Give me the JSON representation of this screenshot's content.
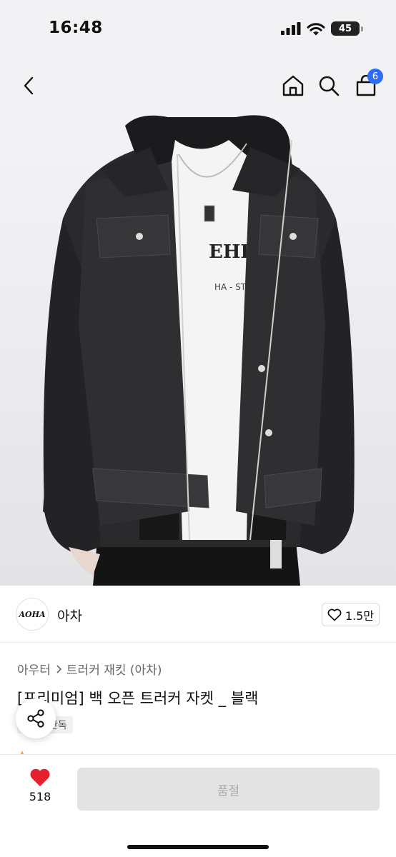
{
  "status_bar": {
    "time": "16:48",
    "battery": "45",
    "battery_level": 0.45
  },
  "header": {
    "back_icon": "chevron-left-icon",
    "home_icon": "home-icon",
    "search_icon": "search-icon",
    "cart_icon": "shopping-bag-icon",
    "cart_count": "6",
    "badge_color": "#2f6df6"
  },
  "product_image": {
    "print_text": "EHIC",
    "print_subtext": "HA - STU"
  },
  "brand": {
    "logo_text": "AOHA",
    "name": "아차",
    "likes": "1.5만"
  },
  "breadcrumb": {
    "category": "아우터",
    "subcategory": "트러커 재킷 (아차)"
  },
  "product": {
    "title": "[프리미엄] 백 오픈 트러커 자켓 _ 블랙",
    "tag": "단독"
  },
  "bottom_bar": {
    "wish_count": "518",
    "heart_color": "#e5202e",
    "soldout_label": "품절"
  }
}
